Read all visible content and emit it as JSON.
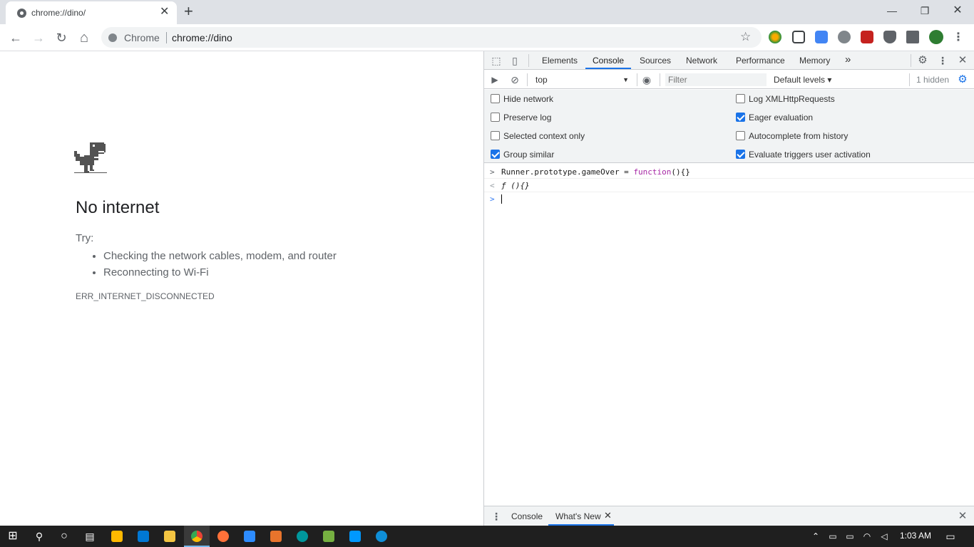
{
  "browser": {
    "tab_title": "chrome://dino/",
    "tab_close": "✕",
    "new_tab": "+",
    "window_controls": {
      "minimize": "—",
      "maximize": "❐",
      "close": "✕"
    },
    "omnibox_brand": "Chrome",
    "omnibox_url": "chrome://dino",
    "star": "☆",
    "nav": {
      "back": "←",
      "forward": "→",
      "reload": "↻",
      "home": "⌂"
    }
  },
  "page": {
    "heading": "No internet",
    "try_label": "Try:",
    "suggestions": [
      "Checking the network cables, modem, and router",
      "Reconnecting to Wi-Fi"
    ],
    "error_code": "ERR_INTERNET_DISCONNECTED"
  },
  "devtools": {
    "tabs": [
      "Elements",
      "Console",
      "Sources",
      "Network",
      "Performance",
      "Memory"
    ],
    "active_tab": "Console",
    "more_tabs": "»",
    "context": "top",
    "filter_placeholder": "Filter",
    "levels": "Default levels ▾",
    "hidden_count": "1 hidden",
    "settings_left": [
      {
        "label": "Hide network",
        "checked": false
      },
      {
        "label": "Preserve log",
        "checked": false
      },
      {
        "label": "Selected context only",
        "checked": false
      },
      {
        "label": "Group similar",
        "checked": true
      }
    ],
    "settings_right": [
      {
        "label": "Log XMLHttpRequests",
        "checked": false
      },
      {
        "label": "Eager evaluation",
        "checked": true
      },
      {
        "label": "Autocomplete from history",
        "checked": false
      },
      {
        "label": "Evaluate triggers user activation",
        "checked": true
      }
    ],
    "console_input": "Runner.prototype.gameOver = ",
    "console_input_kw": "function",
    "console_input_tail": "(){}",
    "console_output": "ƒ (){}",
    "input_prompt": ">",
    "output_prompt": "<",
    "drawer_tabs": [
      "Console",
      "What's New"
    ],
    "drawer_active": "What's New"
  },
  "taskbar": {
    "time": "1:03 AM"
  },
  "colors": {
    "accent": "#1a73e8",
    "keyword": "#a626a4",
    "taskbar": "#1f1f1f"
  }
}
